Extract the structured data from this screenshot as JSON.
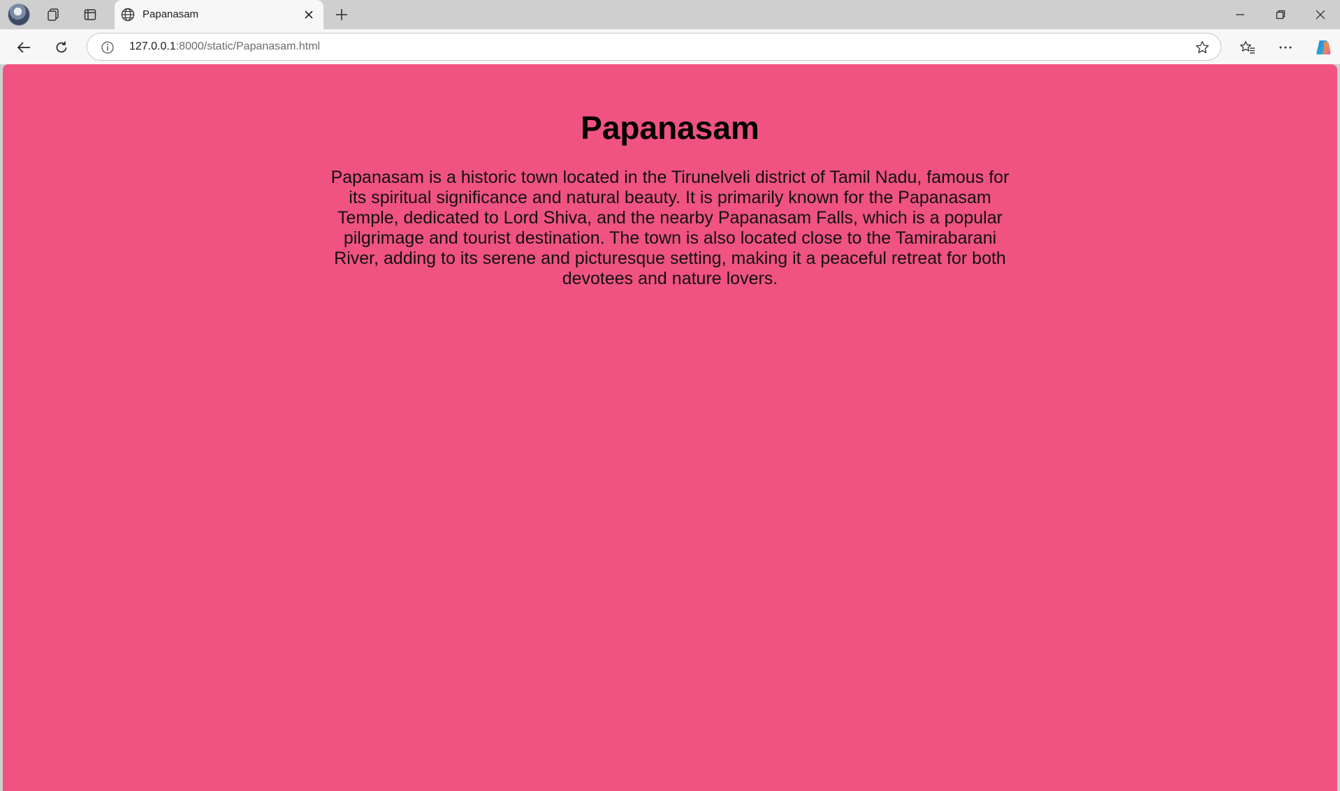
{
  "browser": {
    "tab": {
      "title": "Papanasam"
    },
    "address": {
      "url_host": "127.0.0.1",
      "url_rest": ":8000/static/Papanasam.html"
    },
    "icons": {
      "profile": "profile-avatar",
      "workspaces": "workspaces-icon",
      "tab_actions": "tab-actions-icon",
      "tab_favicon": "globe-icon",
      "tab_close": "close-icon",
      "new_tab": "plus-icon",
      "minimize": "minimize-icon",
      "restore": "restore-icon",
      "close_window": "close-icon",
      "back": "back-arrow-icon",
      "refresh": "refresh-icon",
      "site_info": "info-icon",
      "favorite": "star-icon",
      "favorites": "favorites-icon",
      "more": "more-icon",
      "copilot": "copilot-icon"
    }
  },
  "page": {
    "background": "#f05381",
    "heading": "Papanasam",
    "paragraph": "Papanasam is a historic town located in the Tirunelveli district of Tamil Nadu, famous for its spiritual significance and natural beauty. It is primarily known for the Papanasam Temple, dedicated to Lord Shiva, and the nearby Papanasam Falls, which is a popular pilgrimage and tourist destination. The town is also located close to the Tamirabarani River, adding to its serene and picturesque setting, making it a peaceful retreat for both devotees and nature lovers."
  }
}
